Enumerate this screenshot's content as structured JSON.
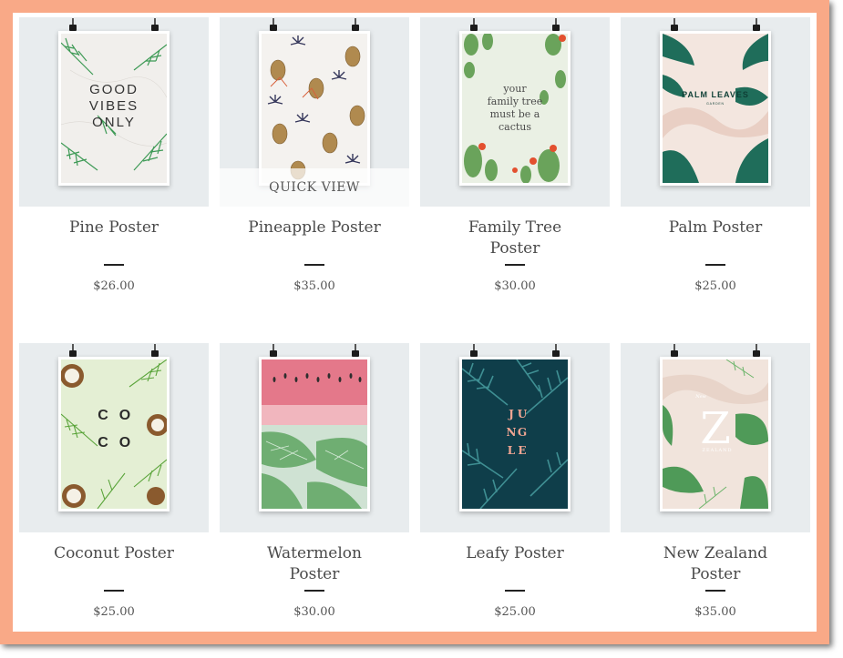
{
  "colors": {
    "frame": "#f9a987",
    "thumb_bg": "#e8ecee",
    "text": "#4a4a4a"
  },
  "products": [
    {
      "name": "Pine Poster",
      "price": "$26.00",
      "art": "good-vibes",
      "art_text": [
        "GOOD",
        "VIBES",
        "ONLY"
      ]
    },
    {
      "name": "Pineapple Poster",
      "price": "$35.00",
      "art": "pineapple",
      "quick_view": "QUICK VIEW"
    },
    {
      "name": "Family Tree Poster",
      "price": "$30.00",
      "art": "cactus",
      "art_text": [
        "your",
        "family tree",
        "must be a",
        "cactus"
      ]
    },
    {
      "name": "Palm Poster",
      "price": "$25.00",
      "art": "palm",
      "art_text": [
        "PALM LEAVES",
        "GARDEN"
      ]
    },
    {
      "name": "Coconut Poster",
      "price": "$25.00",
      "art": "coco",
      "art_text": [
        "C",
        "O",
        "C",
        "O"
      ]
    },
    {
      "name": "Watermelon Poster",
      "price": "$30.00",
      "art": "watermelon"
    },
    {
      "name": "Leafy Poster",
      "price": "$25.00",
      "art": "jungle",
      "art_text": [
        "J",
        "U",
        "N",
        "G",
        "L",
        "E"
      ]
    },
    {
      "name": "New Zealand Poster",
      "price": "$35.00",
      "art": "nz",
      "art_text": [
        "New",
        "Z",
        "ZEALAND"
      ]
    }
  ]
}
